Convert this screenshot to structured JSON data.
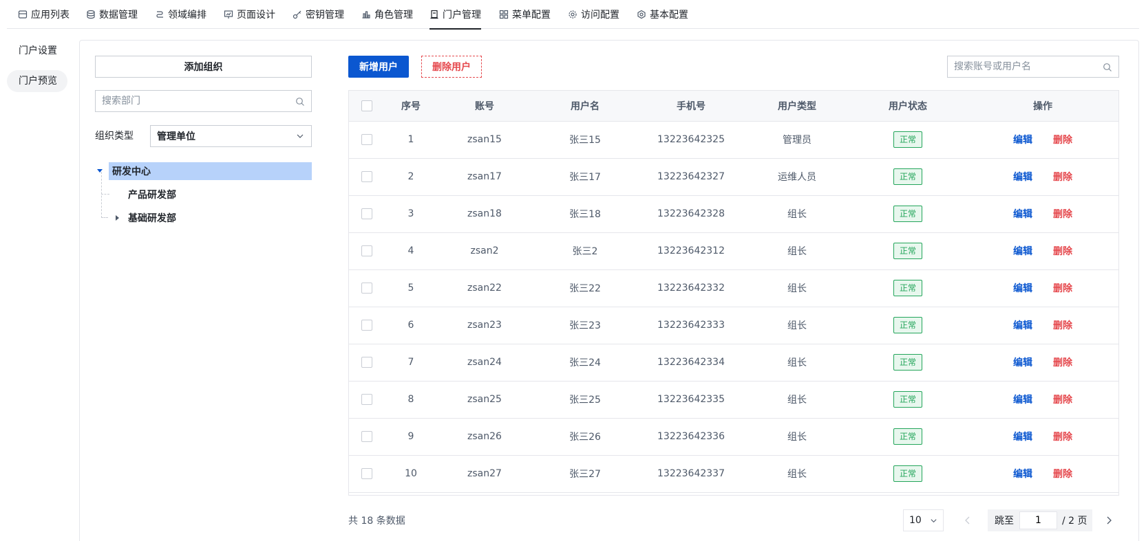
{
  "topnav": {
    "items": [
      {
        "label": "应用列表",
        "icon": "app-store-icon"
      },
      {
        "label": "数据管理",
        "icon": "database-icon"
      },
      {
        "label": "领域编排",
        "icon": "flow-icon"
      },
      {
        "label": "页面设计",
        "icon": "page-design-icon"
      },
      {
        "label": "密钥管理",
        "icon": "key-icon"
      },
      {
        "label": "角色管理",
        "icon": "role-icon"
      },
      {
        "label": "门户管理",
        "icon": "portal-icon"
      },
      {
        "label": "菜单配置",
        "icon": "grid-icon"
      },
      {
        "label": "访问配置",
        "icon": "gear-icon"
      },
      {
        "label": "基本配置",
        "icon": "settings-icon"
      }
    ],
    "active_index": 6
  },
  "sidenav": {
    "items": [
      {
        "label": "门户设置"
      },
      {
        "label": "门户预览"
      }
    ],
    "active_index": 1
  },
  "org": {
    "add_button": "添加组织",
    "search_placeholder": "搜索部门",
    "type_label": "组织类型",
    "type_value": "管理单位",
    "tree": [
      {
        "label": "研发中心",
        "level": 0,
        "expanded": true,
        "selected": true
      },
      {
        "label": "产品研发部",
        "level": 1
      },
      {
        "label": "基础研发部",
        "level": 1,
        "expanded": false
      }
    ]
  },
  "users": {
    "new_button": "新增用户",
    "delete_button": "删除用户",
    "search_placeholder": "搜索账号或用户名",
    "columns": [
      "序号",
      "账号",
      "用户名",
      "手机号",
      "用户类型",
      "用户状态",
      "操作"
    ],
    "edit_label": "编辑",
    "delete_label": "删除",
    "rows": [
      {
        "no": "1",
        "account": "zsan15",
        "name": "张三15",
        "phone": "13223642325",
        "type": "管理员",
        "status": "正常"
      },
      {
        "no": "2",
        "account": "zsan17",
        "name": "张三17",
        "phone": "13223642327",
        "type": "运维人员",
        "status": "正常"
      },
      {
        "no": "3",
        "account": "zsan18",
        "name": "张三18",
        "phone": "13223642328",
        "type": "组长",
        "status": "正常"
      },
      {
        "no": "4",
        "account": "zsan2",
        "name": "张三2",
        "phone": "13223642312",
        "type": "组长",
        "status": "正常"
      },
      {
        "no": "5",
        "account": "zsan22",
        "name": "张三22",
        "phone": "13223642332",
        "type": "组长",
        "status": "正常"
      },
      {
        "no": "6",
        "account": "zsan23",
        "name": "张三23",
        "phone": "13223642333",
        "type": "组长",
        "status": "正常"
      },
      {
        "no": "7",
        "account": "zsan24",
        "name": "张三24",
        "phone": "13223642334",
        "type": "组长",
        "status": "正常"
      },
      {
        "no": "8",
        "account": "zsan25",
        "name": "张三25",
        "phone": "13223642335",
        "type": "组长",
        "status": "正常"
      },
      {
        "no": "9",
        "account": "zsan26",
        "name": "张三26",
        "phone": "13223642336",
        "type": "组长",
        "status": "正常"
      },
      {
        "no": "10",
        "account": "zsan27",
        "name": "张三27",
        "phone": "13223642337",
        "type": "组长",
        "status": "正常"
      }
    ]
  },
  "pagination": {
    "total_text": "共 18 条数据",
    "page_size": "10",
    "jump_label": "跳至",
    "current_page": "1",
    "total_pages_text": "/ 2 页"
  },
  "colors": {
    "primary": "#0b57d0",
    "danger": "#e5484d",
    "success": "#23a55a",
    "tree_selected": "#b7d2fa"
  }
}
